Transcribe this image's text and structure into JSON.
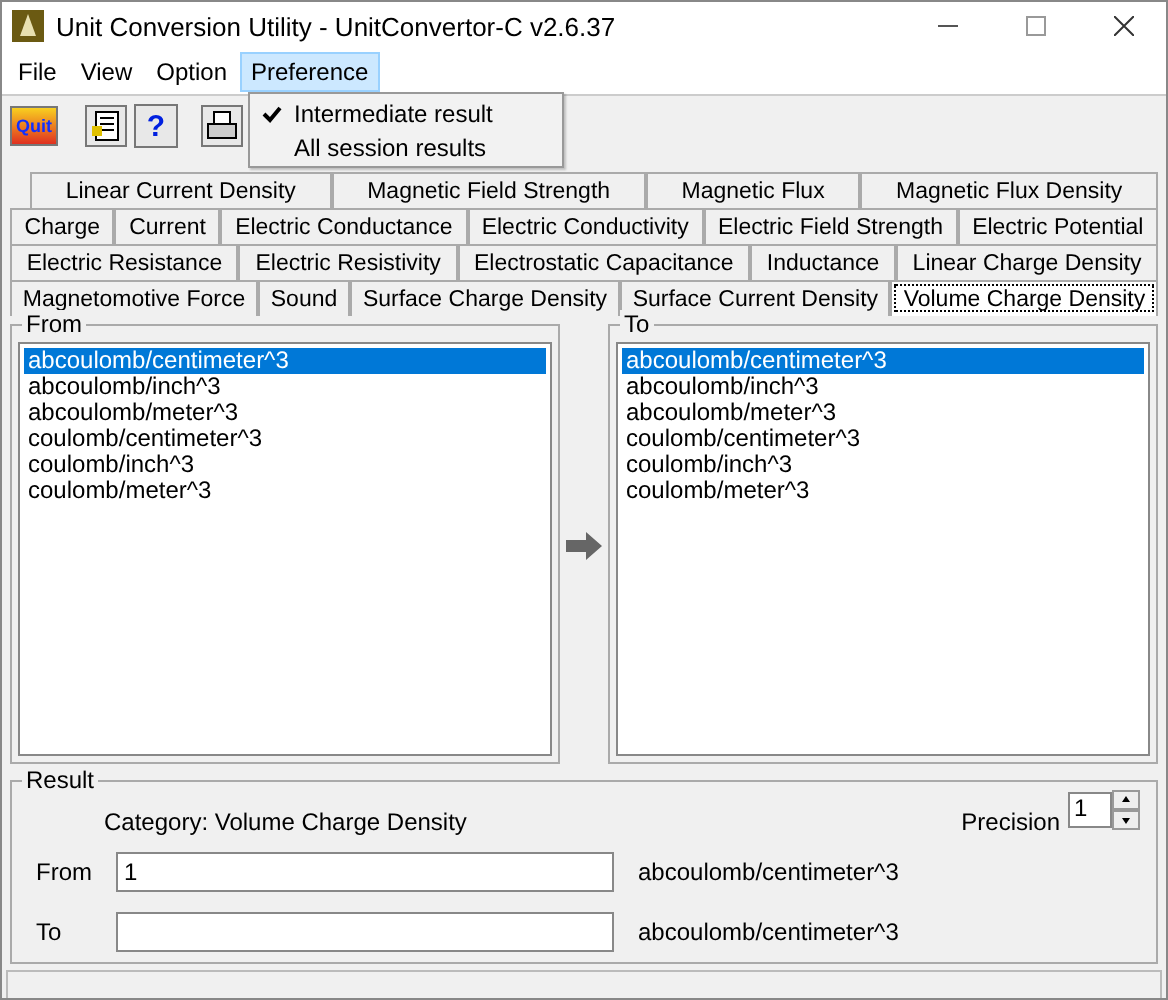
{
  "window": {
    "title": "Unit Conversion Utility - UnitConvertor-C v2.6.37"
  },
  "menu": [
    {
      "label": "File",
      "selected": false
    },
    {
      "label": "View",
      "selected": false
    },
    {
      "label": "Option",
      "selected": false
    },
    {
      "label": "Preference",
      "selected": true
    }
  ],
  "dropdown": [
    {
      "label": "Intermediate result",
      "checked": true
    },
    {
      "label": "All session results",
      "checked": false
    }
  ],
  "toolbar": {
    "quit": "Quit",
    "help": "?"
  },
  "tab_rows": [
    [
      {
        "label": "Linear Current Density",
        "selected": false
      },
      {
        "label": "Magnetic Field Strength",
        "selected": false
      },
      {
        "label": "Magnetic Flux",
        "selected": false
      },
      {
        "label": "Magnetic Flux Density",
        "selected": false
      }
    ],
    [
      {
        "label": "Charge",
        "selected": false
      },
      {
        "label": "Current",
        "selected": false
      },
      {
        "label": "Electric Conductance",
        "selected": false
      },
      {
        "label": "Electric Conductivity",
        "selected": false
      },
      {
        "label": "Electric Field Strength",
        "selected": false
      },
      {
        "label": "Electric Potential",
        "selected": false
      }
    ],
    [
      {
        "label": "Electric Resistance",
        "selected": false
      },
      {
        "label": "Electric Resistivity",
        "selected": false
      },
      {
        "label": "Electrostatic Capacitance",
        "selected": false
      },
      {
        "label": "Inductance",
        "selected": false
      },
      {
        "label": "Linear Charge Density",
        "selected": false
      }
    ],
    [
      {
        "label": "Magnetomotive Force",
        "selected": false
      },
      {
        "label": "Sound",
        "selected": false
      },
      {
        "label": "Surface Charge Density",
        "selected": false
      },
      {
        "label": "Surface Current Density",
        "selected": false
      },
      {
        "label": "Volume Charge Density",
        "selected": true
      }
    ]
  ],
  "from": {
    "title": "From",
    "items": [
      {
        "label": "abcoulomb/centimeter^3",
        "selected": true
      },
      {
        "label": "abcoulomb/inch^3",
        "selected": false
      },
      {
        "label": "abcoulomb/meter^3",
        "selected": false
      },
      {
        "label": "coulomb/centimeter^3",
        "selected": false
      },
      {
        "label": "coulomb/inch^3",
        "selected": false
      },
      {
        "label": "coulomb/meter^3",
        "selected": false
      }
    ]
  },
  "to": {
    "title": "To",
    "items": [
      {
        "label": "abcoulomb/centimeter^3",
        "selected": true
      },
      {
        "label": "abcoulomb/inch^3",
        "selected": false
      },
      {
        "label": "abcoulomb/meter^3",
        "selected": false
      },
      {
        "label": "coulomb/centimeter^3",
        "selected": false
      },
      {
        "label": "coulomb/inch^3",
        "selected": false
      },
      {
        "label": "coulomb/meter^3",
        "selected": false
      }
    ]
  },
  "result": {
    "title": "Result",
    "category": "Category: Volume Charge Density",
    "precision_label": "Precision",
    "precision": "1",
    "from_label": "From",
    "from_value": "1",
    "from_unit": "abcoulomb/centimeter^3",
    "to_label": "To",
    "to_unit": "abcoulomb/centimeter^3"
  }
}
